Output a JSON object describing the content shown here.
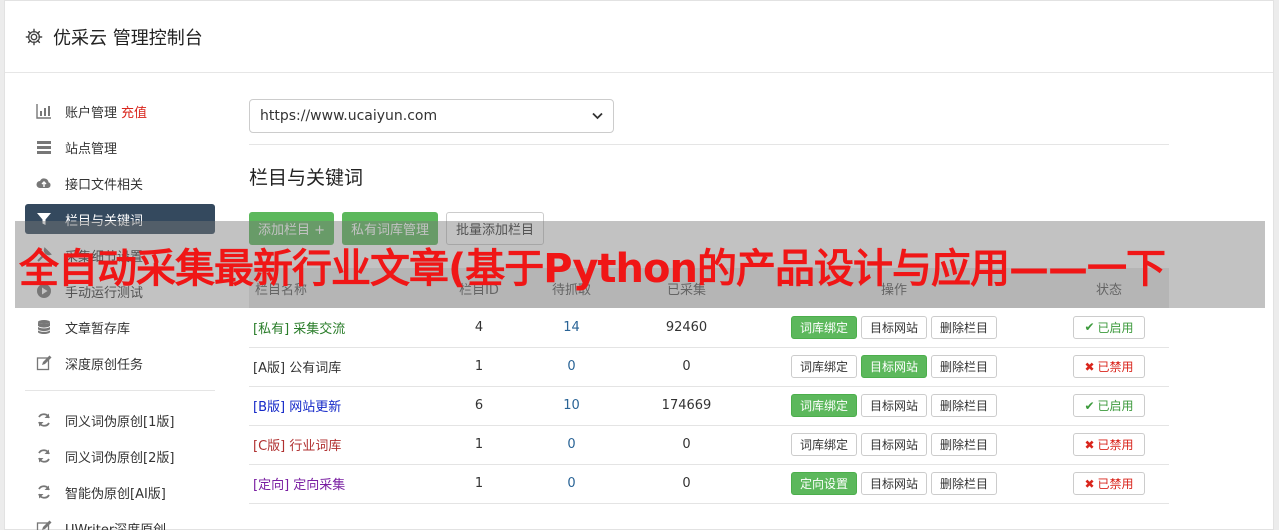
{
  "header": {
    "title": "优采云 管理控制台",
    "icon": "gear-icon"
  },
  "sidebar": {
    "items": [
      {
        "label": "账户管理",
        "extra": "充值",
        "icon": "bar-chart-icon",
        "active": false
      },
      {
        "label": "站点管理",
        "icon": "server-icon",
        "active": false
      },
      {
        "label": "接口文件相关",
        "icon": "cloud-upload-icon",
        "active": false
      },
      {
        "label": "栏目与关键词",
        "icon": "filter-icon",
        "active": true
      },
      {
        "label": "采集细节设置",
        "icon": "wrench-icon",
        "active": false
      },
      {
        "label": "手动运行测试",
        "icon": "play-circle-icon",
        "active": false
      },
      {
        "label": "文章暂存库",
        "icon": "database-icon",
        "active": false
      },
      {
        "label": "深度原创任务",
        "icon": "edit-icon",
        "active": false
      }
    ],
    "items2": [
      {
        "label": "同义词伪原创[1版]",
        "icon": "refresh-icon"
      },
      {
        "label": "同义词伪原创[2版]",
        "icon": "refresh-icon"
      },
      {
        "label": "智能伪原创[AI版]",
        "icon": "refresh-icon"
      },
      {
        "label": "UWriter深度原创",
        "icon": "edit-icon"
      }
    ]
  },
  "site_select": {
    "value": "https://www.ucaiyun.com"
  },
  "section": {
    "title": "栏目与关键词"
  },
  "buttons": {
    "add_column": "添加栏目 +",
    "private_lib": "私有词库管理",
    "batch_add": "批量添加栏目"
  },
  "table": {
    "headers": [
      "栏目名称",
      "栏目ID",
      "待抓取",
      "已采集",
      "操作",
      "状态"
    ],
    "rows": [
      {
        "tag": "[私有]",
        "name": "采集交流",
        "id": "4",
        "pending": "14",
        "collected": "92460",
        "op1": "词库绑定",
        "op2": "目标网站",
        "op3": "删除栏目",
        "green": "op1",
        "status": "已启用",
        "on": true,
        "cls": "c-green",
        "pendingBlue": true
      },
      {
        "tag": "[A版]",
        "name": "公有词库",
        "id": "1",
        "pending": "0",
        "collected": "0",
        "op1": "词库绑定",
        "op2": "目标网站",
        "op3": "删除栏目",
        "green": "op2",
        "status": "已禁用",
        "on": false,
        "cls": "c-dark",
        "pendingBlue": true
      },
      {
        "tag": "[B版]",
        "name": "网站更新",
        "id": "6",
        "pending": "10",
        "collected": "174669",
        "op1": "词库绑定",
        "op2": "目标网站",
        "op3": "删除栏目",
        "green": "op1",
        "status": "已启用",
        "on": true,
        "cls": "c-blue",
        "pendingBlue": true
      },
      {
        "tag": "[C版]",
        "name": "行业词库",
        "id": "1",
        "pending": "0",
        "collected": "0",
        "op1": "词库绑定",
        "op2": "目标网站",
        "op3": "删除栏目",
        "green": "",
        "status": "已禁用",
        "on": false,
        "cls": "c-red",
        "pendingBlue": true
      },
      {
        "tag": "[定向]",
        "name": "定向采集",
        "id": "1",
        "pending": "0",
        "collected": "0",
        "op1": "定向设置",
        "op2": "目标网站",
        "op3": "删除栏目",
        "green": "op1",
        "status": "已禁用",
        "on": false,
        "cls": "c-purple",
        "pendingBlue": true
      }
    ]
  },
  "overlay": {
    "text": "全自动采集最新行业文章(基于Python的产品设计与应用——一下"
  },
  "colors": {
    "sidebar_active": "#34495e",
    "green": "#5cb85c",
    "red": "#d9251c",
    "overlay_text": "#f01616"
  }
}
